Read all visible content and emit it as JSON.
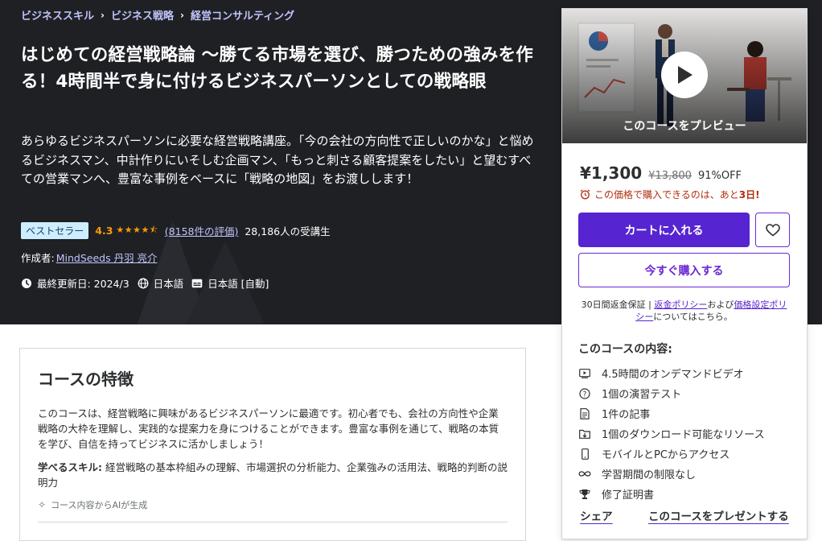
{
  "breadcrumb": [
    "ビジネススキル",
    "ビジネス戦略",
    "経営コンサルティング"
  ],
  "course": {
    "title": "はじめての経営戦略論 〜勝てる市場を選び、勝つための強みを作る！4時間半で身に付けるビジネスパーソンとしての戦略眼",
    "subtitle": "あらゆるビジネスパーソンに必要な経営戦略講座。「今の会社の方向性で正しいのかな」と悩めるビジネスマン、中計作りにいそしむ企画マン、「もっと刺さる顧客提案をしたい」と望むすべての営業マンへ、豊富な事例をベースに「戦略の地図」をお渡しします！",
    "badge": "ベストセラー",
    "rating": "4.3",
    "rating_stars": 4.3,
    "rating_count": "(8158件の評価)",
    "students": "28,186人の受講生",
    "author_label": "作成者:",
    "author": "MindSeeds 丹羽 亮介",
    "updated": "最終更新日: 2024/3",
    "language": "日本語",
    "captions": "日本語 [自動]"
  },
  "card": {
    "preview_label": "このコースをプレビュー",
    "price": "¥1,300",
    "original_price": "¥13,800",
    "discount": "91%OFF",
    "timer_prefix": "この価格で購入できるのは、あと",
    "timer_days": "3日!",
    "cart_button": "カートに入れる",
    "buy_button": "今すぐ購入する",
    "guarantee_prefix": "30日間返金保証 | ",
    "refund_policy": "返金ポリシー",
    "guarantee_and": "および",
    "pricing_policy": "価格設定ポリシー",
    "guarantee_suffix": "についてはこちら。",
    "includes_title": "このコースの内容:",
    "includes": [
      {
        "icon": "video-icon",
        "label": "4.5時間のオンデマンドビデオ"
      },
      {
        "icon": "quiz-icon",
        "label": "1個の演習テスト"
      },
      {
        "icon": "article-icon",
        "label": "1件の記事"
      },
      {
        "icon": "download-icon",
        "label": "1個のダウンロード可能なリソース"
      },
      {
        "icon": "mobile-icon",
        "label": "モバイルとPCからアクセス"
      },
      {
        "icon": "infinity-icon",
        "label": "学習期間の制限なし"
      },
      {
        "icon": "trophy-icon",
        "label": "修了証明書"
      }
    ],
    "share": "シェア",
    "gift": "このコースをプレゼントする"
  },
  "features": {
    "heading": "コースの特徴",
    "description": "このコースは、経営戦略に興味があるビジネスパーソンに最適です。初心者でも、会社の方向性や企業戦略の大枠を理解し、実践的な提案力を身につけることができます。豊富な事例を通じて、戦略の本質を学び、自信を持ってビジネスに活かしましょう！",
    "skills_label": "学べるスキル:",
    "skills": " 経営戦略の基本枠組みの理解、市場選択の分析能力、企業強みの活用法、戦略的判断の説明力",
    "ai_note": "コース内容からAIが生成"
  },
  "colors": {
    "hero_bg": "#1f2024",
    "accent": "#5624d0",
    "link_light": "#c0c4fc",
    "star": "#f69c08",
    "badge_bg": "#cceeff",
    "timer": "#b32d0f"
  }
}
